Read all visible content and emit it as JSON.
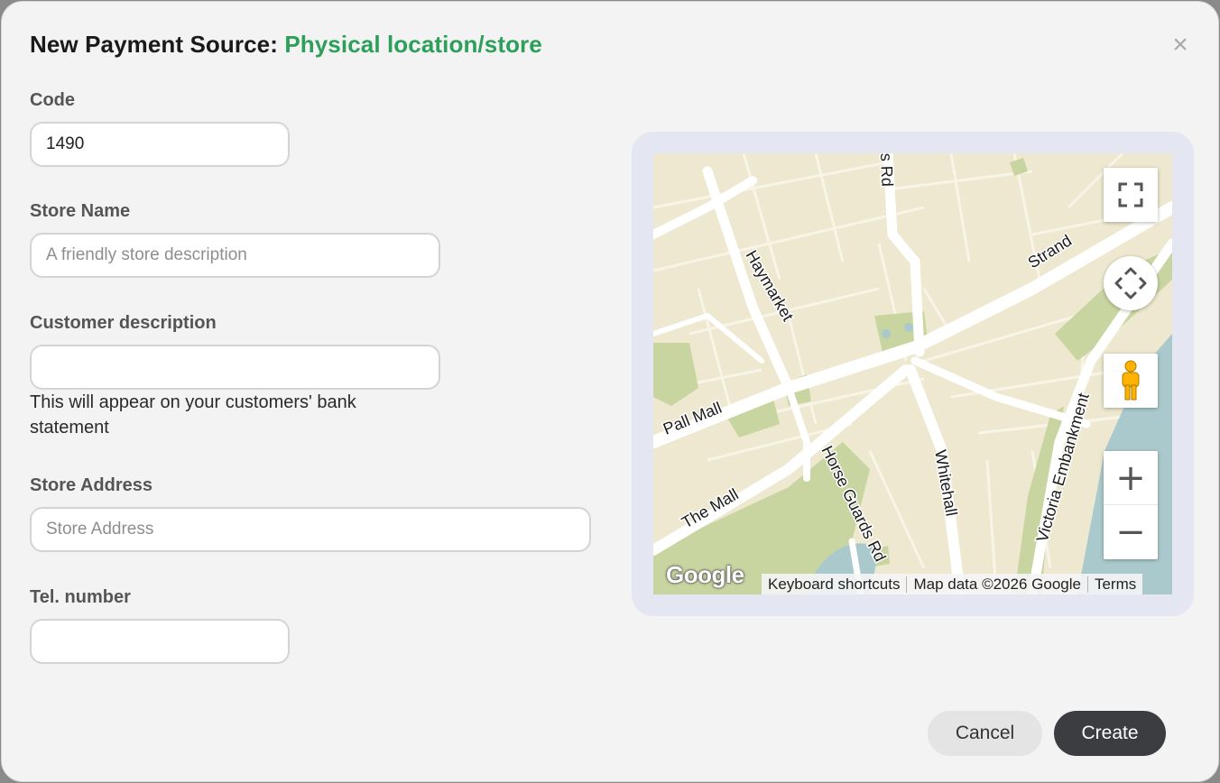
{
  "modal": {
    "title_prefix": "New Payment Source:",
    "title_accent": "Physical location/store",
    "close_symbol": "×"
  },
  "form": {
    "code": {
      "label": "Code",
      "value": "1490",
      "placeholder": ""
    },
    "store_name": {
      "label": "Store Name",
      "value": "",
      "placeholder": "A friendly store description"
    },
    "customer_description": {
      "label": "Customer description",
      "value": "",
      "placeholder": "",
      "hint": "This will appear on your customers' bank statement"
    },
    "store_address": {
      "label": "Store Address",
      "value": "",
      "placeholder": "Store Address"
    },
    "tel_number": {
      "label": "Tel. number",
      "value": "",
      "placeholder": ""
    }
  },
  "map": {
    "streets": [
      "Haymarket",
      "Strand",
      "Pall Mall",
      "The Mall",
      "Horse Guards Rd",
      "Whitehall",
      "Victoria Embankment",
      "s Rd"
    ],
    "logo_text": "Google",
    "attribution": [
      "Keyboard shortcuts",
      "Map data ©2026 Google",
      "Terms"
    ],
    "controls": {
      "zoom_in": "+",
      "zoom_out": "−"
    },
    "colors": {
      "land": "#ede8cf",
      "park": "#c9d5a0",
      "water": "#aac9cc",
      "road": "#ffffff"
    }
  },
  "actions": {
    "cancel": "Cancel",
    "create": "Create"
  }
}
